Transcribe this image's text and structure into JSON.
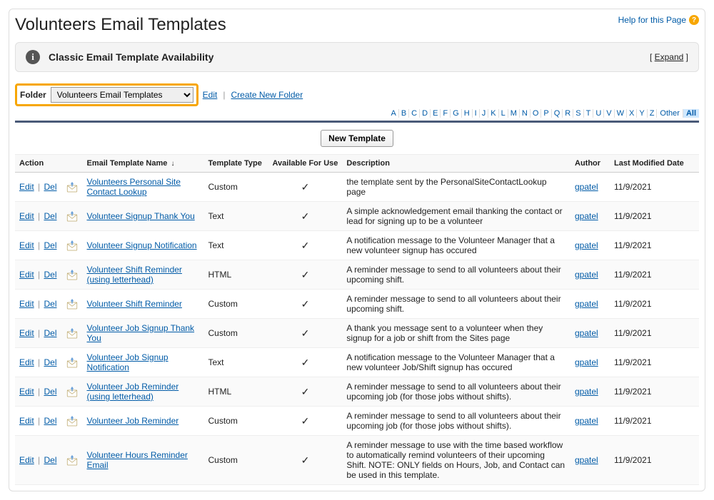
{
  "header": {
    "title": "Volunteers Email Templates",
    "help_text": "Help for this Page"
  },
  "section": {
    "title": "Classic Email Template Availability",
    "expand_label": "Expand"
  },
  "folder": {
    "label": "Folder",
    "selected": "Volunteers Email Templates",
    "edit_label": "Edit",
    "create_label": "Create New Folder"
  },
  "alpha": {
    "letters": [
      "A",
      "B",
      "C",
      "D",
      "E",
      "F",
      "G",
      "H",
      "I",
      "J",
      "K",
      "L",
      "M",
      "N",
      "O",
      "P",
      "Q",
      "R",
      "S",
      "T",
      "U",
      "V",
      "W",
      "X",
      "Y",
      "Z"
    ],
    "other_label": "Other",
    "all_label": "All"
  },
  "toolbar": {
    "new_template_label": "New Template"
  },
  "columns": {
    "action": "Action",
    "name": "Email Template Name",
    "type": "Template Type",
    "available": "Available For Use",
    "description": "Description",
    "author": "Author",
    "modified": "Last Modified Date"
  },
  "row_labels": {
    "edit": "Edit",
    "del": "Del"
  },
  "author_common": "gpatel",
  "date_common": "11/9/2021",
  "rows": [
    {
      "name": "Volunteers Personal Site Contact Lookup",
      "type": "Custom",
      "available": true,
      "description": "the template sent by the PersonalSiteContactLookup page"
    },
    {
      "name": "Volunteer Signup Thank You",
      "type": "Text",
      "available": true,
      "description": "A simple acknowledgement email thanking the contact or lead for signing up to be a volunteer"
    },
    {
      "name": "Volunteer Signup Notification",
      "type": "Text",
      "available": true,
      "description": "A notification message to the Volunteer Manager that a new volunteer signup has occured"
    },
    {
      "name": "Volunteer Shift Reminder (using letterhead)",
      "type": "HTML",
      "available": true,
      "description": "A reminder message to send to all volunteers about their upcoming shift."
    },
    {
      "name": "Volunteer Shift Reminder",
      "type": "Custom",
      "available": true,
      "description": "A reminder message to send to all volunteers about their upcoming shift."
    },
    {
      "name": "Volunteer Job Signup Thank You",
      "type": "Custom",
      "available": true,
      "description": "A thank you message sent to a volunteer when they signup for a job or shift from the Sites page"
    },
    {
      "name": "Volunteer Job Signup Notification",
      "type": "Text",
      "available": true,
      "description": "A notification message to the Volunteer Manager that a new volunteer Job/Shift signup has occured"
    },
    {
      "name": "Volunteer Job Reminder (using letterhead)",
      "type": "HTML",
      "available": true,
      "description": "A reminder message to send to all volunteers about their upcoming job (for those jobs without shifts)."
    },
    {
      "name": "Volunteer Job Reminder",
      "type": "Custom",
      "available": true,
      "description": "A reminder message to send to all volunteers about their upcoming job (for those jobs without shifts)."
    },
    {
      "name": "Volunteer Hours Reminder Email",
      "type": "Custom",
      "available": true,
      "description": "A reminder message to use with the time based workflow to automatically remind volunteers of their upcoming Shift. NOTE: ONLY fields on Hours, Job, and Contact can be used in this template."
    }
  ]
}
